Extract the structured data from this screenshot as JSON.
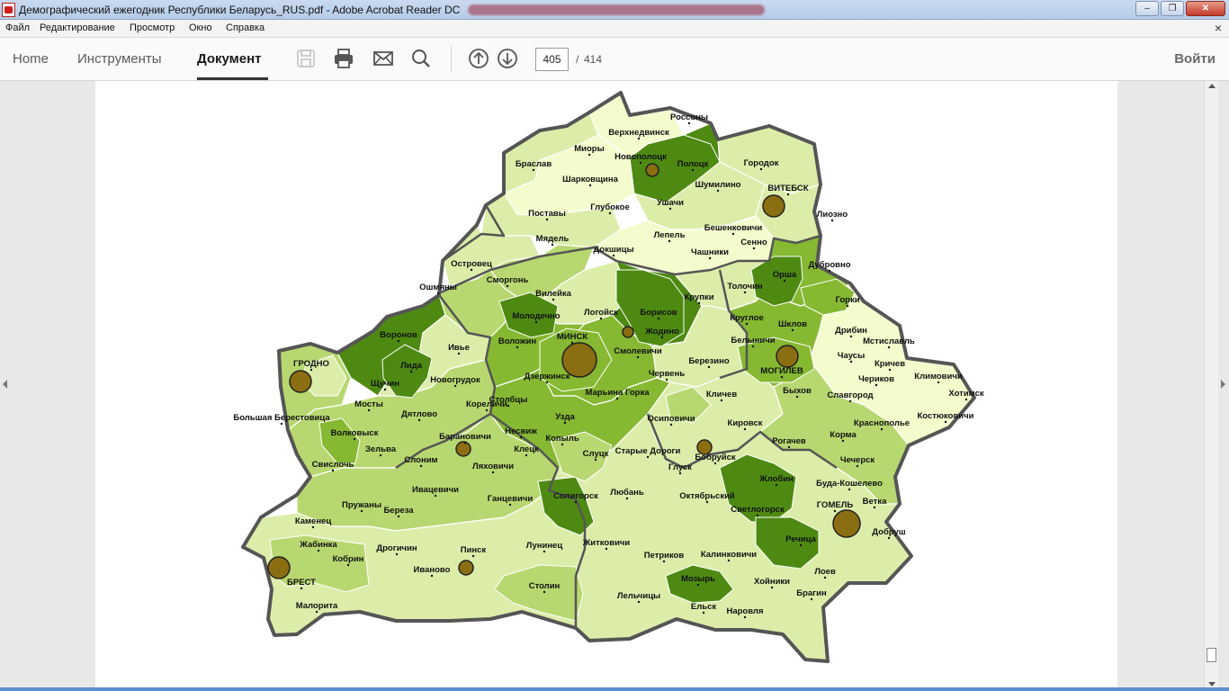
{
  "window": {
    "title": "Демографический ежегодник Республики Беларусь_RUS.pdf - Adobe Acrobat Reader DC",
    "controls": {
      "minimize": "‒",
      "restore": "❐",
      "close": "✕"
    }
  },
  "menu": {
    "items": [
      "Файл",
      "Редактирование",
      "Просмотр",
      "Окно",
      "Справка"
    ],
    "close_symbol": "×"
  },
  "toolbar": {
    "tabs": [
      "Home",
      "Инструменты",
      "Документ"
    ],
    "active_tab": "Документ",
    "tools": [
      "save-icon",
      "print-icon",
      "email-icon",
      "search-icon",
      "page-up-icon",
      "page-down-icon"
    ],
    "current_page": "405",
    "page_separator": "/",
    "total_pages": "414",
    "signin_label": "Войти"
  },
  "map": {
    "colors": {
      "level1": "#f4fccd",
      "level2": "#dcedaa",
      "level3": "#b7d870",
      "level4": "#86b832",
      "level5": "#4e8a12",
      "border": "#555555",
      "city_marker": "#8b6d12"
    },
    "cities": [
      "МИНСК",
      "ГРОДНО",
      "БРЕСТ",
      "ВИТЕБСК",
      "МОГИЛЕВ",
      "ГОМЕЛЬ",
      "Новополоцк",
      "Жодино",
      "Бобруйск",
      "Барановичи",
      "Пинск"
    ],
    "labels": [
      "Россоны",
      "Верхнедвинск",
      "Миоры",
      "Новополоцк",
      "Полоцк",
      "Городок",
      "Браслав",
      "Шарковщина",
      "Шумилино",
      "ВИТЕБСК",
      "Глубокое",
      "Ушачи",
      "Поставы",
      "Лиозно",
      "Бешенковичи",
      "Мядель",
      "Лепель",
      "Сенно",
      "Докшицы",
      "Чашники",
      "Островец",
      "Дубровно",
      "Сморгонь",
      "Орша",
      "Ошмяны",
      "Вилейка",
      "Толочин",
      "Крупки",
      "Борисов",
      "Логойск",
      "Горки",
      "Молодечно",
      "Круглое",
      "Шклов",
      "Жодино",
      "Дрибин",
      "Воронов",
      "Воложин",
      "МИНСК",
      "Мстиславль",
      "Белыничи",
      "Ивье",
      "Смолевичи",
      "Чаусы",
      "Кричев",
      "Березино",
      "Климовичи",
      "ГРОДНО",
      "Лида",
      "МОГИЛЕВ",
      "Дзержинск",
      "Новогрудок",
      "Щучин",
      "Червень",
      "Марьина Горка",
      "Чериков",
      "Хотимск",
      "Быхов",
      "Славгород",
      "Кличев",
      "Мосты",
      "Кореличи",
      "Столбцы",
      "Большая Берестовица",
      "Дятлово",
      "Узда",
      "Осиповичи",
      "Костюковичи",
      "Кировск",
      "Краснополье",
      "Несвиж",
      "Волковыск",
      "Копыль",
      "Барановичи",
      "Корма",
      "Рогачев",
      "Бобруйск",
      "Зельва",
      "Клецк",
      "Старые Дороги",
      "Слуцк",
      "Слоним",
      "Свислочь",
      "Чечерск",
      "Ляховичи",
      "Глуск",
      "Жлобин",
      "Буда-Кошелево",
      "Октябрьский",
      "Ивацевичи",
      "Солигорск",
      "Любань",
      "Ганцевичи",
      "Ветка",
      "ГОМЕЛЬ",
      "Пружаны",
      "Светлогорск",
      "Береза",
      "Каменец",
      "Добруш",
      "Речица",
      "Жабинка",
      "Житковичи",
      "Лунинец",
      "Петриков",
      "Калинковичи",
      "Дрогичин",
      "Пинск",
      "Кобрин",
      "Иваново",
      "Лоев",
      "Хойники",
      "БРЕСТ",
      "Мозырь",
      "Столин",
      "Брагин",
      "Лельчицы",
      "Ельск",
      "Наровля",
      "Малорита"
    ]
  }
}
